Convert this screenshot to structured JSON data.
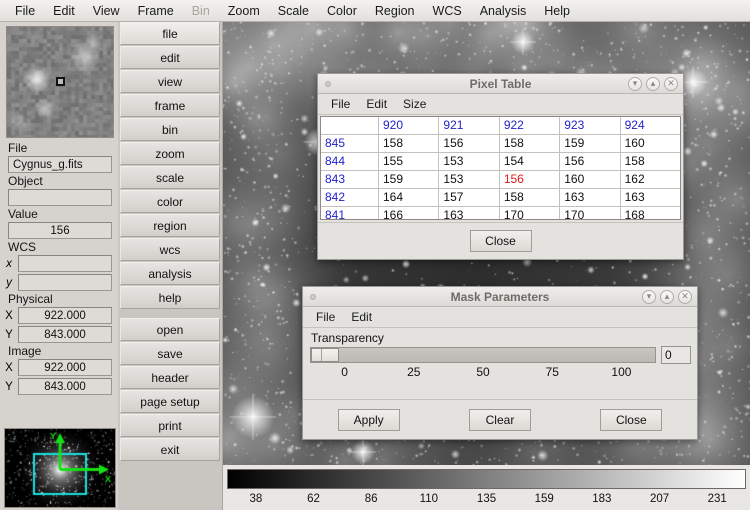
{
  "menubar": {
    "items": [
      {
        "label": "File",
        "disabled": false
      },
      {
        "label": "Edit",
        "disabled": false
      },
      {
        "label": "View",
        "disabled": false
      },
      {
        "label": "Frame",
        "disabled": false
      },
      {
        "label": "Bin",
        "disabled": true
      },
      {
        "label": "Zoom",
        "disabled": false
      },
      {
        "label": "Scale",
        "disabled": false
      },
      {
        "label": "Color",
        "disabled": false
      },
      {
        "label": "Region",
        "disabled": false
      },
      {
        "label": "WCS",
        "disabled": false
      },
      {
        "label": "Analysis",
        "disabled": false
      },
      {
        "label": "Help",
        "disabled": false
      }
    ]
  },
  "info_panel": {
    "file_label": "File",
    "file_value": "Cygnus_g.fits",
    "object_label": "Object",
    "object_value": "",
    "value_label": "Value",
    "value_value": "156",
    "wcs_label": "WCS",
    "wcs_x_axis": "x",
    "wcs_x_value": "",
    "wcs_y_axis": "y",
    "wcs_y_value": "",
    "physical_label": "Physical",
    "physical_x_axis": "X",
    "physical_x_value": "922.000",
    "physical_y_axis": "Y",
    "physical_y_value": "843.000",
    "image_label": "Image",
    "image_x_axis": "X",
    "image_x_value": "922.000",
    "image_y_axis": "Y",
    "image_y_value": "843.000"
  },
  "button_column": {
    "top_buttons": [
      "file",
      "edit",
      "view",
      "frame",
      "bin",
      "zoom",
      "scale",
      "color",
      "region",
      "wcs",
      "analysis",
      "help"
    ],
    "bottom_buttons": [
      "open",
      "save",
      "header",
      "page setup",
      "print",
      "exit"
    ]
  },
  "colorbar": {
    "ticks": [
      "38",
      "62",
      "86",
      "110",
      "135",
      "159",
      "183",
      "207",
      "231"
    ]
  },
  "pixel_table": {
    "title": "Pixel Table",
    "menu": [
      "File",
      "Edit",
      "Size"
    ],
    "column_headers": [
      "920",
      "921",
      "922",
      "923",
      "924"
    ],
    "row_headers": [
      "845",
      "844",
      "843",
      "842",
      "841"
    ],
    "rows": [
      [
        "158",
        "156",
        "158",
        "159",
        "160"
      ],
      [
        "155",
        "153",
        "154",
        "156",
        "158"
      ],
      [
        "159",
        "153",
        "156",
        "160",
        "162"
      ],
      [
        "164",
        "157",
        "158",
        "163",
        "163"
      ],
      [
        "166",
        "163",
        "170",
        "170",
        "168"
      ]
    ],
    "highlight": {
      "row": 2,
      "col": 2
    },
    "close_label": "Close",
    "minimize_icon": "chevron-down-icon",
    "maximize_icon": "chevron-up-icon",
    "close_icon": "close-icon"
  },
  "mask_parameters": {
    "title": "Mask Parameters",
    "menu": [
      "File",
      "Edit"
    ],
    "transparency_label": "Transparency",
    "transparency_value": "0",
    "slider_ticks": [
      "0",
      "25",
      "50",
      "75",
      "100"
    ],
    "buttons": [
      "Apply",
      "Clear",
      "Close"
    ],
    "minimize_icon": "chevron-down-icon",
    "maximize_icon": "chevron-up-icon",
    "close_icon": "close-icon"
  }
}
